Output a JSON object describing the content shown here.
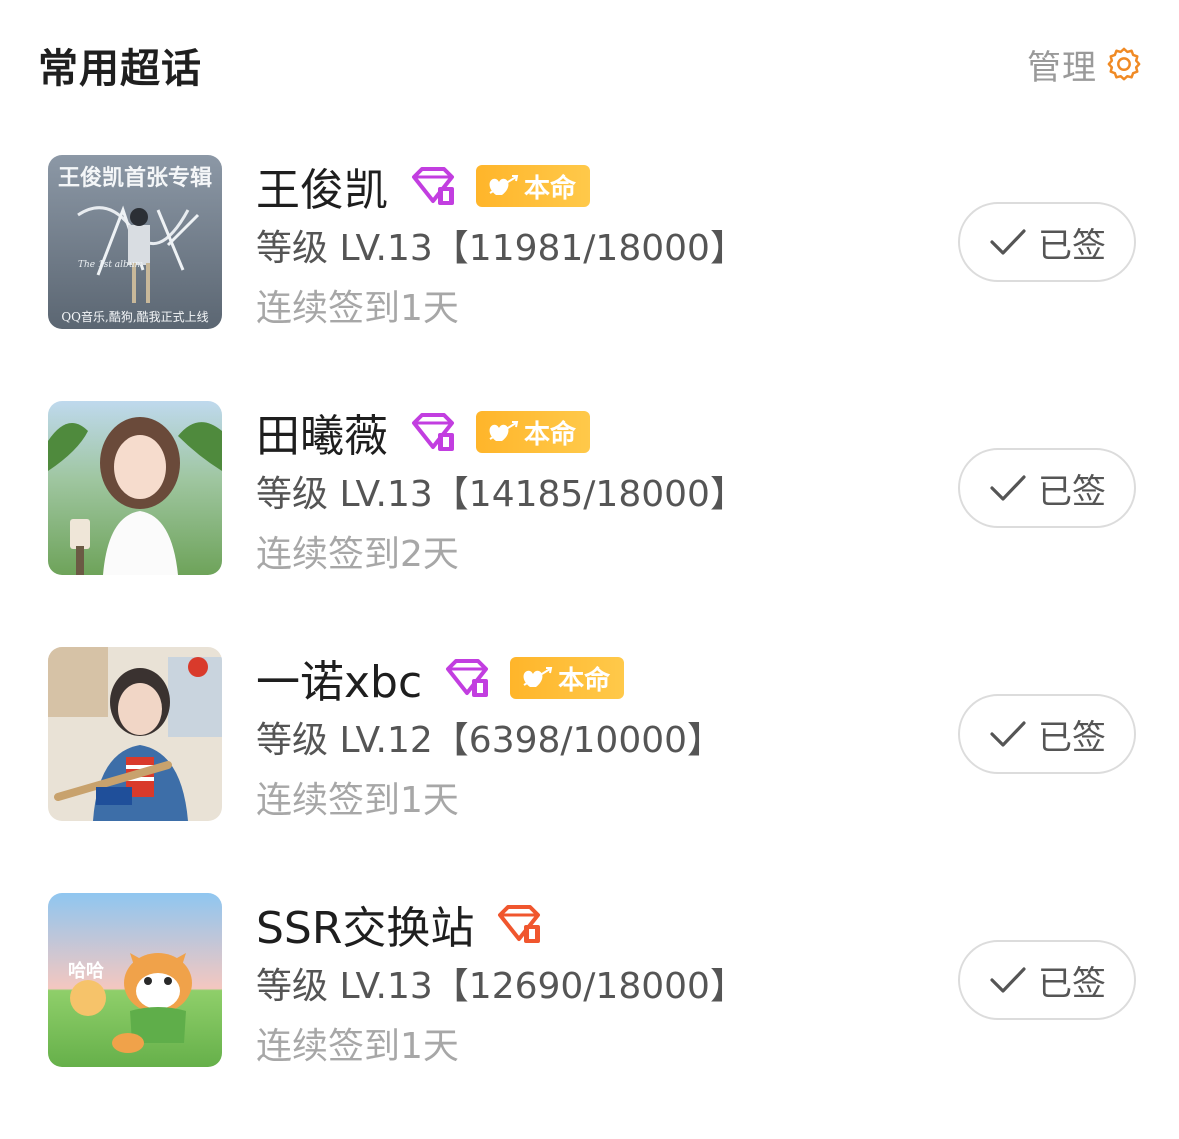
{
  "header": {
    "title": "常用超话",
    "manage_label": "管理",
    "manage_icon": "gear-icon"
  },
  "colors": {
    "accent_orange": "#f08a24",
    "badge_gold": "#ffb52a",
    "diamond_purple": "#c23ee0",
    "diamond_orange": "#f0562e",
    "level_text": "#555555",
    "streak_text": "#a7a7a7"
  },
  "topics": [
    {
      "name": "王俊凯",
      "diamond_icon": "purple-diamond-icon",
      "badge": "本命",
      "level": "等级 LV.13【11981/18000】",
      "streak": "连续签到1天",
      "button_label": "已签",
      "thumb_text_top": "王俊凯首张专辑",
      "thumb_text_bottom": "QQ音乐,酷狗,酷我正式上线",
      "thumb_text_mid": "The 1st album"
    },
    {
      "name": "田曦薇",
      "diamond_icon": "purple-diamond-icon",
      "badge": "本命",
      "level": "等级 LV.13【14185/18000】",
      "streak": "连续签到2天",
      "button_label": "已签"
    },
    {
      "name": "一诺xbc",
      "diamond_icon": "purple-diamond-icon",
      "badge": "本命",
      "level": "等级 LV.12【6398/10000】",
      "streak": "连续签到1天",
      "button_label": "已签"
    },
    {
      "name": "SSR交换站",
      "diamond_icon": "orange-diamond-icon",
      "badge": "",
      "level": "等级 LV.13【12690/18000】",
      "streak": "连续签到1天",
      "button_label": "已签",
      "thumb_text": "哈哈"
    }
  ]
}
